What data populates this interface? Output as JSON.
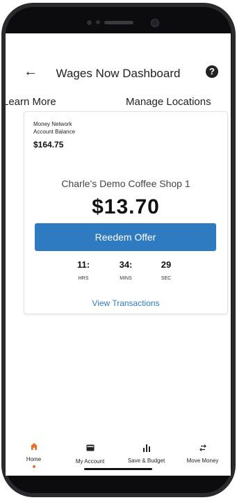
{
  "header": {
    "title": "Wages Now Dashboard",
    "back_icon": "←",
    "help_icon": "?"
  },
  "links": {
    "learn_more": "Learn More",
    "manage_locations": "Manage Locations"
  },
  "card": {
    "balance_label_1": "Money Network",
    "balance_label_2": "Account Balance",
    "balance_value": "$164.75",
    "merchant": "Charle's Demo Coffee Shop 1",
    "amount": "$13.70",
    "redeem_label": "Reedem Offer",
    "timer": [
      {
        "value": "11:",
        "unit": "HRS"
      },
      {
        "value": "34:",
        "unit": "MINS"
      },
      {
        "value": "29",
        "unit": "SEC"
      }
    ],
    "view_transactions": "View Transactions"
  },
  "tabbar": {
    "items": [
      {
        "label": "Home",
        "icon": "home-icon",
        "active": true
      },
      {
        "label": "My Account",
        "icon": "card-icon",
        "active": false
      },
      {
        "label": "Save & Budget",
        "icon": "bar-chart-icon",
        "active": false
      },
      {
        "label": "Move Money",
        "icon": "transfer-icon",
        "active": false
      }
    ]
  },
  "colors": {
    "accent": "#2f7bc1",
    "active_tab": "#e8702a"
  }
}
